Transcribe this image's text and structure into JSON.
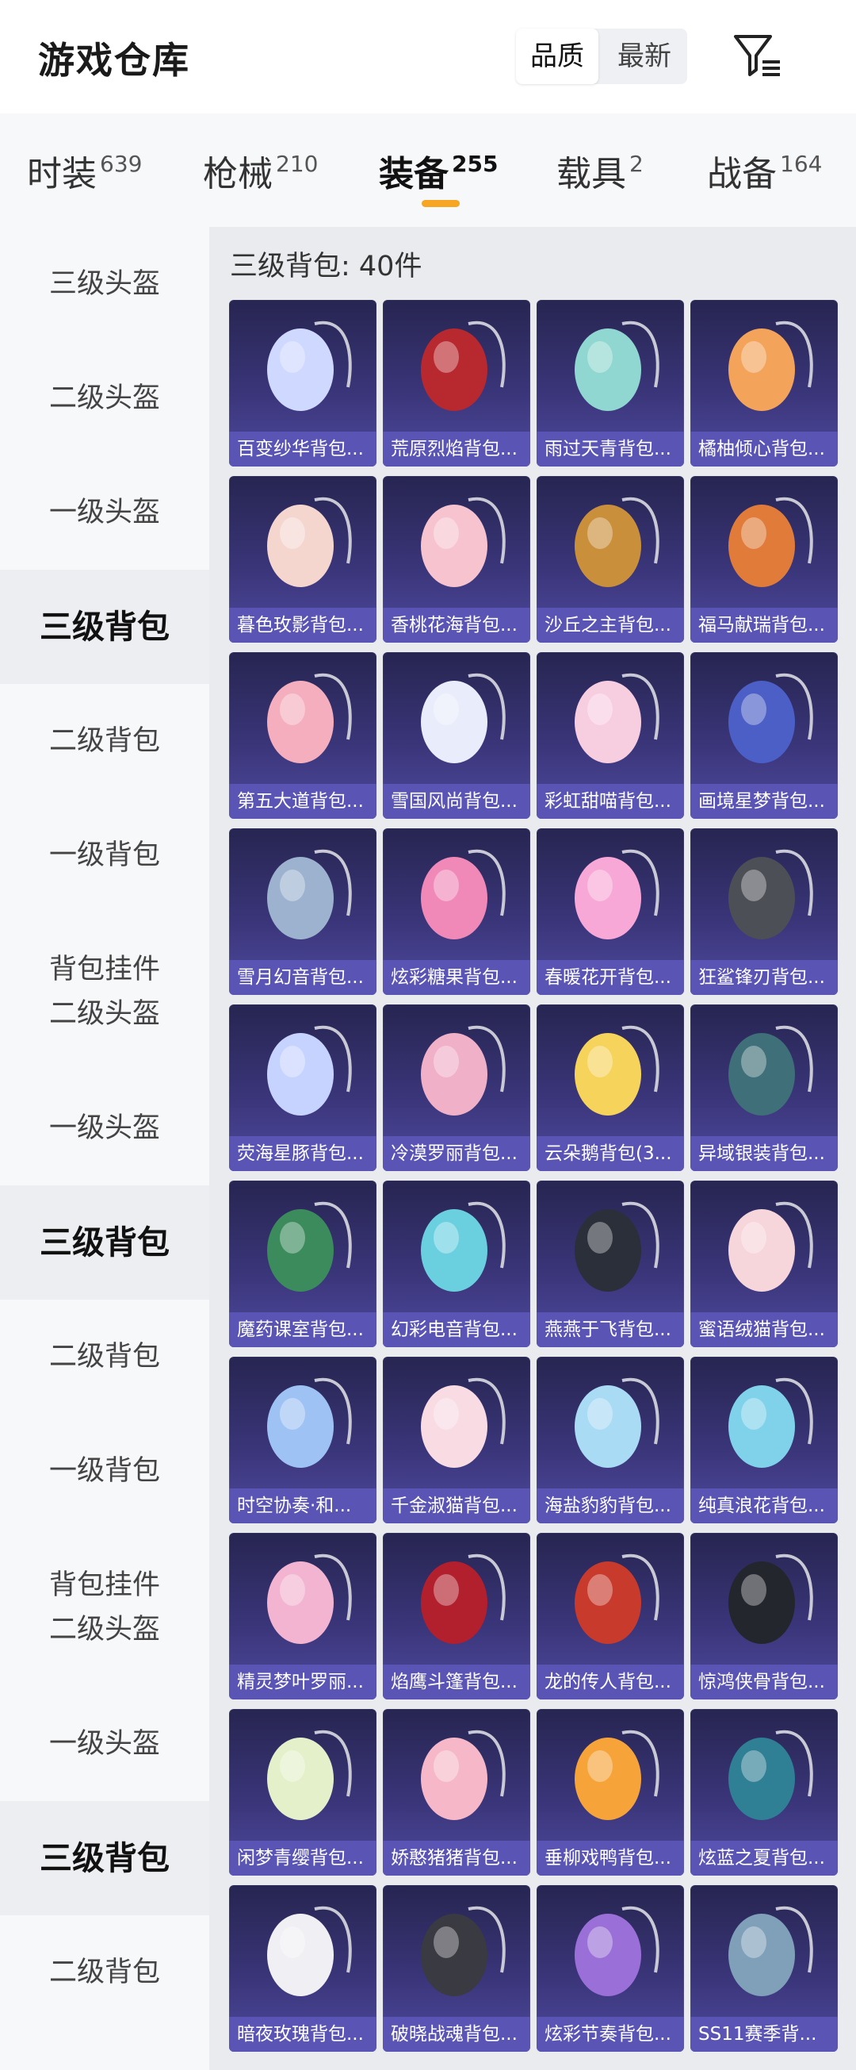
{
  "app_title": "游戏仓库",
  "sort": {
    "options": [
      "品质",
      "最新"
    ],
    "active": 0
  },
  "tabs": [
    {
      "label": "时装",
      "count": "639"
    },
    {
      "label": "枪械",
      "count": "210"
    },
    {
      "label": "装备",
      "count": "255",
      "active": true
    },
    {
      "label": "载具",
      "count": "2"
    },
    {
      "label": "战备",
      "count": "164"
    }
  ],
  "sidebar": [
    {
      "lines": [
        "三级头盔"
      ]
    },
    {
      "lines": [
        "二级头盔"
      ]
    },
    {
      "lines": [
        "一级头盔"
      ]
    },
    {
      "lines": [
        "三级背包"
      ],
      "active": true
    },
    {
      "lines": [
        "二级背包"
      ]
    },
    {
      "lines": [
        "一级背包"
      ]
    },
    {
      "lines": [
        "背包挂件",
        "二级头盔"
      ]
    },
    {
      "lines": [
        "一级头盔"
      ]
    },
    {
      "lines": [
        "三级背包"
      ],
      "active": true
    },
    {
      "lines": [
        "二级背包"
      ]
    },
    {
      "lines": [
        "一级背包"
      ]
    },
    {
      "lines": [
        "背包挂件",
        "二级头盔"
      ]
    },
    {
      "lines": [
        "一级头盔"
      ]
    },
    {
      "lines": [
        "三级背包"
      ],
      "active": true
    },
    {
      "lines": [
        "二级背包"
      ]
    }
  ],
  "section_title": "三级背包: 40件",
  "items": [
    {
      "name": "百变纱华背包...",
      "accent": "#cfd8ff"
    },
    {
      "name": "荒原烈焰背包...",
      "accent": "#b8282f"
    },
    {
      "name": "雨过天青背包...",
      "accent": "#8fd7d0"
    },
    {
      "name": "橘柚倾心背包...",
      "accent": "#f3a45a"
    },
    {
      "name": "暮色玫影背包...",
      "accent": "#f4d6cf"
    },
    {
      "name": "香桃花海背包...",
      "accent": "#f6c3cf"
    },
    {
      "name": "沙丘之主背包...",
      "accent": "#c98f3a"
    },
    {
      "name": "福马献瑞背包...",
      "accent": "#e07b3a"
    },
    {
      "name": "第五大道背包...",
      "accent": "#f4aebd"
    },
    {
      "name": "雪国风尚背包...",
      "accent": "#e9ecfb"
    },
    {
      "name": "彩虹甜喵背包...",
      "accent": "#f7cde0"
    },
    {
      "name": "画境星梦背包...",
      "accent": "#4b5fc7"
    },
    {
      "name": "雪月幻音背包...",
      "accent": "#9cb2cf"
    },
    {
      "name": "炫彩糖果背包...",
      "accent": "#f089b8"
    },
    {
      "name": "春暖花开背包...",
      "accent": "#f7a8d6"
    },
    {
      "name": "狂鲨锋刃背包...",
      "accent": "#4d4f57"
    },
    {
      "name": "荧海星豚背包...",
      "accent": "#c7d3ff"
    },
    {
      "name": "冷漠罗丽背包...",
      "accent": "#f0b0c8"
    },
    {
      "name": "云朵鹅背包(3...",
      "accent": "#f6d35a"
    },
    {
      "name": "异域银装背包...",
      "accent": "#3f6f78"
    },
    {
      "name": "魔药课室背包...",
      "accent": "#3b8b5c"
    },
    {
      "name": "幻彩电音背包...",
      "accent": "#6ad0e0"
    },
    {
      "name": "燕燕于飞背包...",
      "accent": "#2b2f3a"
    },
    {
      "name": "蜜语绒猫背包...",
      "accent": "#f6d5db"
    },
    {
      "name": "时空协奏·和...",
      "accent": "#9fc2f5"
    },
    {
      "name": "千金淑猫背包...",
      "accent": "#f8dbe3"
    },
    {
      "name": "海盐豹豹背包...",
      "accent": "#a9dbf5"
    },
    {
      "name": "纯真浪花背包...",
      "accent": "#7fd2ea"
    },
    {
      "name": "精灵梦叶罗丽...",
      "accent": "#f2b4d0"
    },
    {
      "name": "焰鹰斗篷背包...",
      "accent": "#b21f2d"
    },
    {
      "name": "龙的传人背包...",
      "accent": "#c83a2c"
    },
    {
      "name": "惊鸿侠骨背包...",
      "accent": "#24262d"
    },
    {
      "name": "闲梦青缨背包...",
      "accent": "#e3f0c9"
    },
    {
      "name": "娇憨猪猪背包...",
      "accent": "#f6b8c8"
    },
    {
      "name": "垂柳戏鸭背包...",
      "accent": "#f6a43a"
    },
    {
      "name": "炫蓝之夏背包...",
      "accent": "#2f7f95"
    },
    {
      "name": "暗夜玫瑰背包...",
      "accent": "#f0f0f4"
    },
    {
      "name": "破晓战魂背包...",
      "accent": "#3a3a42"
    },
    {
      "name": "炫彩节奏背包...",
      "accent": "#9a6fd8"
    },
    {
      "name": "SS11赛季背...",
      "accent": "#7fa0b8"
    }
  ]
}
